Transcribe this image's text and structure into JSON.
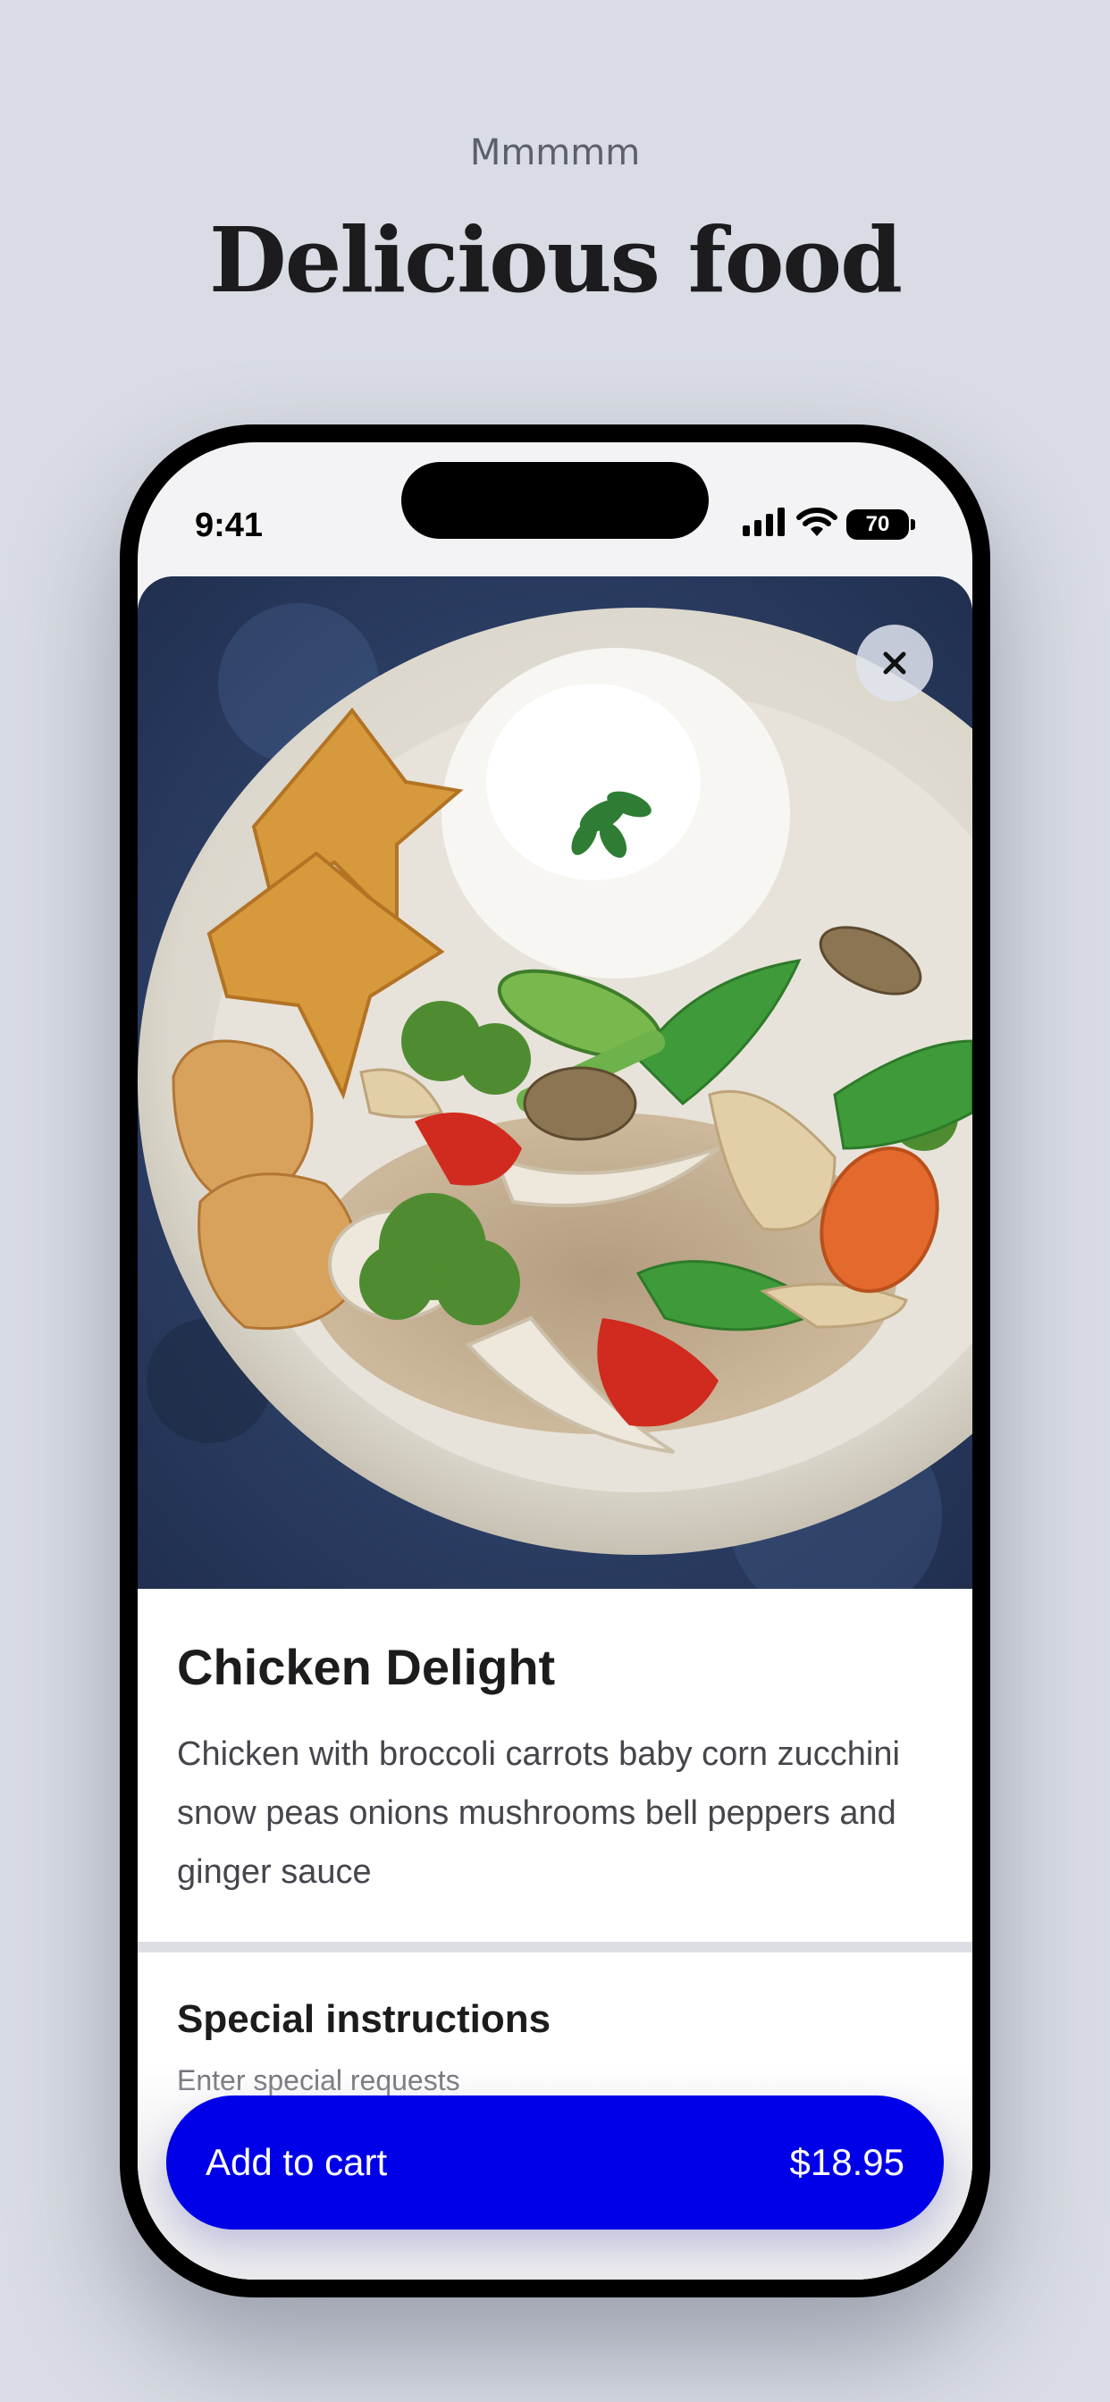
{
  "header": {
    "eyebrow": "Mmmmm",
    "headline": "Delicious food"
  },
  "status_bar": {
    "time": "9:41",
    "battery": "70",
    "icons": [
      "signal-icon",
      "wifi-icon",
      "battery-icon"
    ]
  },
  "item": {
    "title": "Chicken Delight",
    "description": "Chicken with broccoli carrots baby corn zucchini snow peas onions mushrooms bell peppers and ginger sauce",
    "image_alt": "Plate of chicken with rice, vegetables and fried wontons"
  },
  "special": {
    "title": "Special instructions",
    "placeholder": "Enter special requests"
  },
  "cart": {
    "label": "Add to cart",
    "price": "$18.95"
  },
  "colors": {
    "background": "#d9dce4",
    "accent": "#0000e8"
  }
}
